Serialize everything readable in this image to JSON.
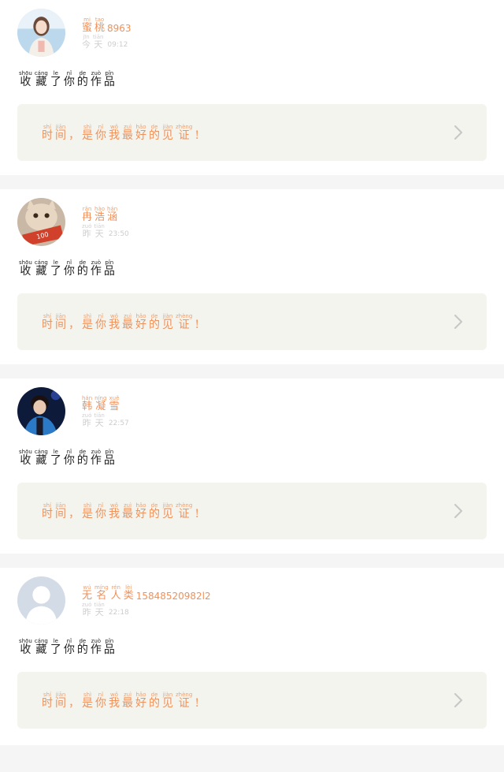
{
  "feed": [
    {
      "avatar_icon": "avatar-girl-photo",
      "name": [
        {
          "py": "mi",
          "hz": "蜜"
        },
        {
          "py": "tao",
          "hz": "桃"
        }
      ],
      "name_suffix": "8963",
      "time_label": [
        {
          "py": "jīn",
          "hz": "今"
        },
        {
          "py": "tiān",
          "hz": "天"
        }
      ],
      "time": "09:12",
      "action": [
        {
          "py": "shōu",
          "hz": "收"
        },
        {
          "py": "cáng",
          "hz": "藏"
        },
        {
          "py": "le",
          "hz": "了"
        },
        {
          "py": "nǐ",
          "hz": "你"
        },
        {
          "py": "de",
          "hz": "的"
        },
        {
          "py": "zuò",
          "hz": "作"
        },
        {
          "py": "pǐn",
          "hz": "品"
        }
      ],
      "quote": [
        {
          "py": "shí",
          "hz": "时"
        },
        {
          "py": "jiān",
          "hz": "间"
        },
        {
          "py": "",
          "hz": "，"
        },
        {
          "py": "shì",
          "hz": "是"
        },
        {
          "py": "nǐ",
          "hz": "你"
        },
        {
          "py": "wǒ",
          "hz": "我"
        },
        {
          "py": "zuì",
          "hz": "最"
        },
        {
          "py": "hǎo",
          "hz": "好"
        },
        {
          "py": "de",
          "hz": "的"
        },
        {
          "py": "jiàn",
          "hz": "见"
        },
        {
          "py": "zhèng",
          "hz": "证"
        },
        {
          "py": "",
          "hz": "!"
        }
      ]
    },
    {
      "avatar_icon": "avatar-cat-photo",
      "name": [
        {
          "py": "rǎn",
          "hz": "冉"
        },
        {
          "py": "hào",
          "hz": "浩"
        },
        {
          "py": "hán",
          "hz": "涵"
        }
      ],
      "name_suffix": "",
      "time_label": [
        {
          "py": "zuó",
          "hz": "昨"
        },
        {
          "py": "tiān",
          "hz": "天"
        }
      ],
      "time": "23:50",
      "action": [
        {
          "py": "shōu",
          "hz": "收"
        },
        {
          "py": "cáng",
          "hz": "藏"
        },
        {
          "py": "le",
          "hz": "了"
        },
        {
          "py": "nǐ",
          "hz": "你"
        },
        {
          "py": "de",
          "hz": "的"
        },
        {
          "py": "zuò",
          "hz": "作"
        },
        {
          "py": "pǐn",
          "hz": "品"
        }
      ],
      "quote": [
        {
          "py": "shí",
          "hz": "时"
        },
        {
          "py": "jiān",
          "hz": "间"
        },
        {
          "py": "",
          "hz": "，"
        },
        {
          "py": "shì",
          "hz": "是"
        },
        {
          "py": "nǐ",
          "hz": "你"
        },
        {
          "py": "wǒ",
          "hz": "我"
        },
        {
          "py": "zuì",
          "hz": "最"
        },
        {
          "py": "hǎo",
          "hz": "好"
        },
        {
          "py": "de",
          "hz": "的"
        },
        {
          "py": "jiàn",
          "hz": "见"
        },
        {
          "py": "zhèng",
          "hz": "证"
        },
        {
          "py": "",
          "hz": "!"
        }
      ]
    },
    {
      "avatar_icon": "avatar-boy-photo",
      "name": [
        {
          "py": "hán",
          "hz": "韩"
        },
        {
          "py": "níng",
          "hz": "凝"
        },
        {
          "py": "xuě",
          "hz": "雪"
        }
      ],
      "name_suffix": "",
      "time_label": [
        {
          "py": "zuó",
          "hz": "昨"
        },
        {
          "py": "tiān",
          "hz": "天"
        }
      ],
      "time": "22:57",
      "action": [
        {
          "py": "shōu",
          "hz": "收"
        },
        {
          "py": "cáng",
          "hz": "藏"
        },
        {
          "py": "le",
          "hz": "了"
        },
        {
          "py": "nǐ",
          "hz": "你"
        },
        {
          "py": "de",
          "hz": "的"
        },
        {
          "py": "zuò",
          "hz": "作"
        },
        {
          "py": "pǐn",
          "hz": "品"
        }
      ],
      "quote": [
        {
          "py": "shí",
          "hz": "时"
        },
        {
          "py": "jiān",
          "hz": "间"
        },
        {
          "py": "",
          "hz": "，"
        },
        {
          "py": "shì",
          "hz": "是"
        },
        {
          "py": "nǐ",
          "hz": "你"
        },
        {
          "py": "wǒ",
          "hz": "我"
        },
        {
          "py": "zuì",
          "hz": "最"
        },
        {
          "py": "hǎo",
          "hz": "好"
        },
        {
          "py": "de",
          "hz": "的"
        },
        {
          "py": "jiàn",
          "hz": "见"
        },
        {
          "py": "zhèng",
          "hz": "证"
        },
        {
          "py": "",
          "hz": "!"
        }
      ]
    },
    {
      "avatar_icon": "default-avatar-icon",
      "name": [
        {
          "py": "wú",
          "hz": "无"
        },
        {
          "py": "míng",
          "hz": "名"
        },
        {
          "py": "rén",
          "hz": "人"
        },
        {
          "py": "lèi",
          "hz": "类"
        }
      ],
      "name_suffix": "15848520982l2",
      "time_label": [
        {
          "py": "zuó",
          "hz": "昨"
        },
        {
          "py": "tiān",
          "hz": "天"
        }
      ],
      "time": "22:18",
      "action": [
        {
          "py": "shōu",
          "hz": "收"
        },
        {
          "py": "cáng",
          "hz": "藏"
        },
        {
          "py": "le",
          "hz": "了"
        },
        {
          "py": "nǐ",
          "hz": "你"
        },
        {
          "py": "de",
          "hz": "的"
        },
        {
          "py": "zuò",
          "hz": "作"
        },
        {
          "py": "pǐn",
          "hz": "品"
        }
      ],
      "quote": [
        {
          "py": "shí",
          "hz": "时"
        },
        {
          "py": "jiān",
          "hz": "间"
        },
        {
          "py": "",
          "hz": "，"
        },
        {
          "py": "shì",
          "hz": "是"
        },
        {
          "py": "nǐ",
          "hz": "你"
        },
        {
          "py": "wǒ",
          "hz": "我"
        },
        {
          "py": "zuì",
          "hz": "最"
        },
        {
          "py": "hǎo",
          "hz": "好"
        },
        {
          "py": "de",
          "hz": "的"
        },
        {
          "py": "jiàn",
          "hz": "见"
        },
        {
          "py": "zhèng",
          "hz": "证"
        },
        {
          "py": "",
          "hz": "!"
        }
      ]
    }
  ],
  "colors": {
    "accent": "#f0915a",
    "quote_bg": "#f4f4ee",
    "separator": "#f5f5f5",
    "chevron": "#c8c8c8"
  }
}
